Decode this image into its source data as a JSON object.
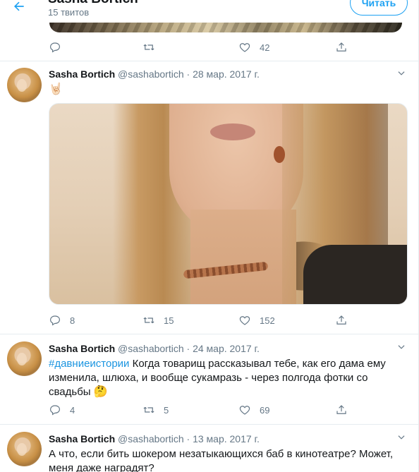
{
  "header": {
    "title": "Sasha Bortich",
    "tweet_count": "15 твитов",
    "follow_label": "Читать"
  },
  "tweets": [
    {
      "counts": {
        "reply": "",
        "retweet": "",
        "like": "42"
      }
    },
    {
      "name": "Sasha Bortich",
      "handle": "@sashabortich",
      "dot": "·",
      "date": "28 мар. 2017 г.",
      "text": "🤘🏻",
      "counts": {
        "reply": "8",
        "retweet": "15",
        "like": "152"
      }
    },
    {
      "name": "Sasha Bortich",
      "handle": "@sashabortich",
      "dot": "·",
      "date": "24 мар. 2017 г.",
      "hashtag": "#давниеистории",
      "text": " Когда товарищ рассказывал тебе, как его дама ему изменила, шлюха, и вообще сукамразь - через полгода фотки со свадьбы ",
      "emoji": "🤔",
      "counts": {
        "reply": "4",
        "retweet": "5",
        "like": "69"
      }
    },
    {
      "name": "Sasha Bortich",
      "handle": "@sashabortich",
      "dot": "·",
      "date": "13 мар. 2017 г.",
      "text": "А что, если бить шокером незатыкающихся баб в кинотеатре? Может, меня даже наградят?"
    }
  ],
  "colors": {
    "accent": "#1da1f2",
    "secondary_text": "#657786",
    "border": "#e6ecf0"
  }
}
